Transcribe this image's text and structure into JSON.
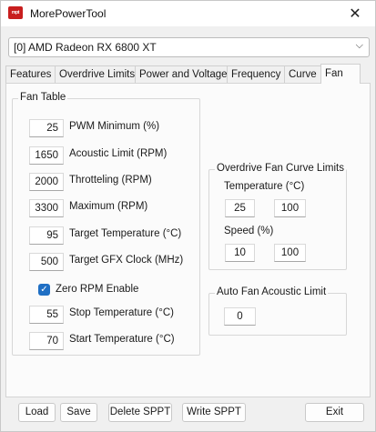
{
  "window": {
    "title": "MorePowerTool",
    "icon_text": "mpt",
    "close_symbol": "✕"
  },
  "gpu_select": {
    "value": "[0] AMD Radeon RX 6800 XT",
    "chevron": "⌵"
  },
  "tabs": [
    {
      "label": "Features"
    },
    {
      "label": "Overdrive Limits"
    },
    {
      "label": "Power and Voltage"
    },
    {
      "label": "Frequency"
    },
    {
      "label": "Curve"
    },
    {
      "label": "Fan"
    }
  ],
  "active_tab": "Fan",
  "fan_table": {
    "title": "Fan Table",
    "rows": [
      {
        "value": "25",
        "label": "PWM Minimum (%)"
      },
      {
        "value": "1650",
        "label": "Acoustic Limit (RPM)"
      },
      {
        "value": "2000",
        "label": "Throtteling (RPM)"
      },
      {
        "value": "3300",
        "label": "Maximum (RPM)"
      },
      {
        "value": "95",
        "label": "Target Temperature (°C)"
      },
      {
        "value": "500",
        "label": "Target GFX Clock (MHz)"
      }
    ],
    "zero_rpm": {
      "label": "Zero RPM Enable",
      "checked": true,
      "check_mark": "✓"
    },
    "stop_temp": {
      "value": "55",
      "label": "Stop Temperature (°C)"
    },
    "start_temp": {
      "value": "70",
      "label": "Start Temperature (°C)"
    }
  },
  "overdrive_fan_curve": {
    "title": "Overdrive Fan Curve Limits",
    "temperature_label": "Temperature (°C)",
    "temperature_min": "25",
    "temperature_max": "100",
    "speed_label": "Speed (%)",
    "speed_min": "10",
    "speed_max": "100"
  },
  "auto_fan": {
    "title": "Auto Fan Acoustic Limit",
    "value": "0"
  },
  "buttons": {
    "load": "Load",
    "save": "Save",
    "delete_sppt": "Delete SPPT",
    "write_sppt": "Write SPPT",
    "exit": "Exit"
  },
  "colors": {
    "accent": "#1f6fc4",
    "icon_red": "#c81e1e"
  }
}
